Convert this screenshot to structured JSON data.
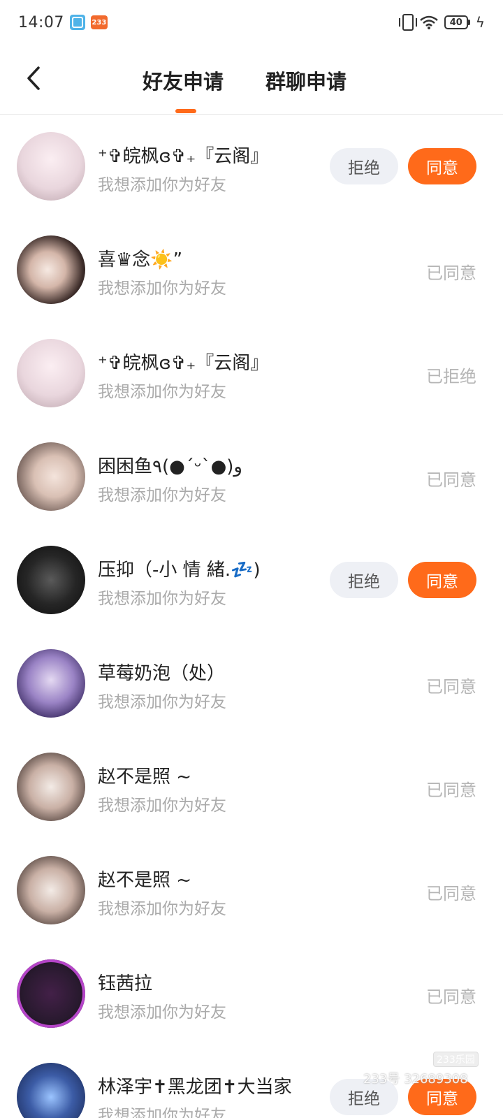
{
  "status_bar": {
    "time": "14:07",
    "app_icon_b": "233",
    "battery": "40"
  },
  "header": {
    "tabs": [
      {
        "label": "好友申请",
        "active": true
      },
      {
        "label": "群聊申请",
        "active": false
      }
    ]
  },
  "colors": {
    "accent": "#ff6a1a",
    "reject_bg": "#eef0f5",
    "muted_text": "#aaaaaa"
  },
  "requests": [
    {
      "name": "⁺✞皖枫ɞ✞₊『云阁』",
      "message": "我想添加你为好友",
      "avatar": "doll-avatar",
      "reject_label": "拒绝",
      "accept_label": "同意"
    },
    {
      "name": "喜♛念☀️”",
      "message": "我想添加你为好友",
      "avatar": "girl-avatar",
      "status": "已同意"
    },
    {
      "name": "⁺✞皖枫ɞ✞₊『云阁』",
      "message": "我想添加你为好友",
      "avatar": "doll-avatar",
      "status": "已拒绝"
    },
    {
      "name": "困困鱼٩(●´ᵕ`●)و",
      "message": "我想添加你为好友",
      "avatar": "blonde-avatar",
      "status": "已同意"
    },
    {
      "name": "压抑（-小 情 緒.💤)",
      "message": "我想添加你为好友",
      "avatar": "dark-avatar",
      "reject_label": "拒绝",
      "accept_label": "同意"
    },
    {
      "name": "草莓奶泡（处）",
      "message": "我想添加你为好友",
      "avatar": "purple-avatar",
      "status": "已同意"
    },
    {
      "name": "赵不是照 ~",
      "message": "我想添加你为好友",
      "avatar": "girl2-avatar",
      "status": "已同意"
    },
    {
      "name": "赵不是照 ~",
      "message": "我想添加你为好友",
      "avatar": "girl2-avatar",
      "status": "已同意"
    },
    {
      "name": "钰茜拉",
      "message": "我想添加你为好友",
      "avatar": "neon-avatar",
      "status": "已同意"
    },
    {
      "name": "林泽宇✝黑龙团✝大当家",
      "message": "我想添加你为好友",
      "avatar": "blue-avatar",
      "reject_label": "拒绝",
      "accept_label": "同意"
    }
  ],
  "watermark": {
    "text": "233号 32689308",
    "logo": "233乐园"
  }
}
